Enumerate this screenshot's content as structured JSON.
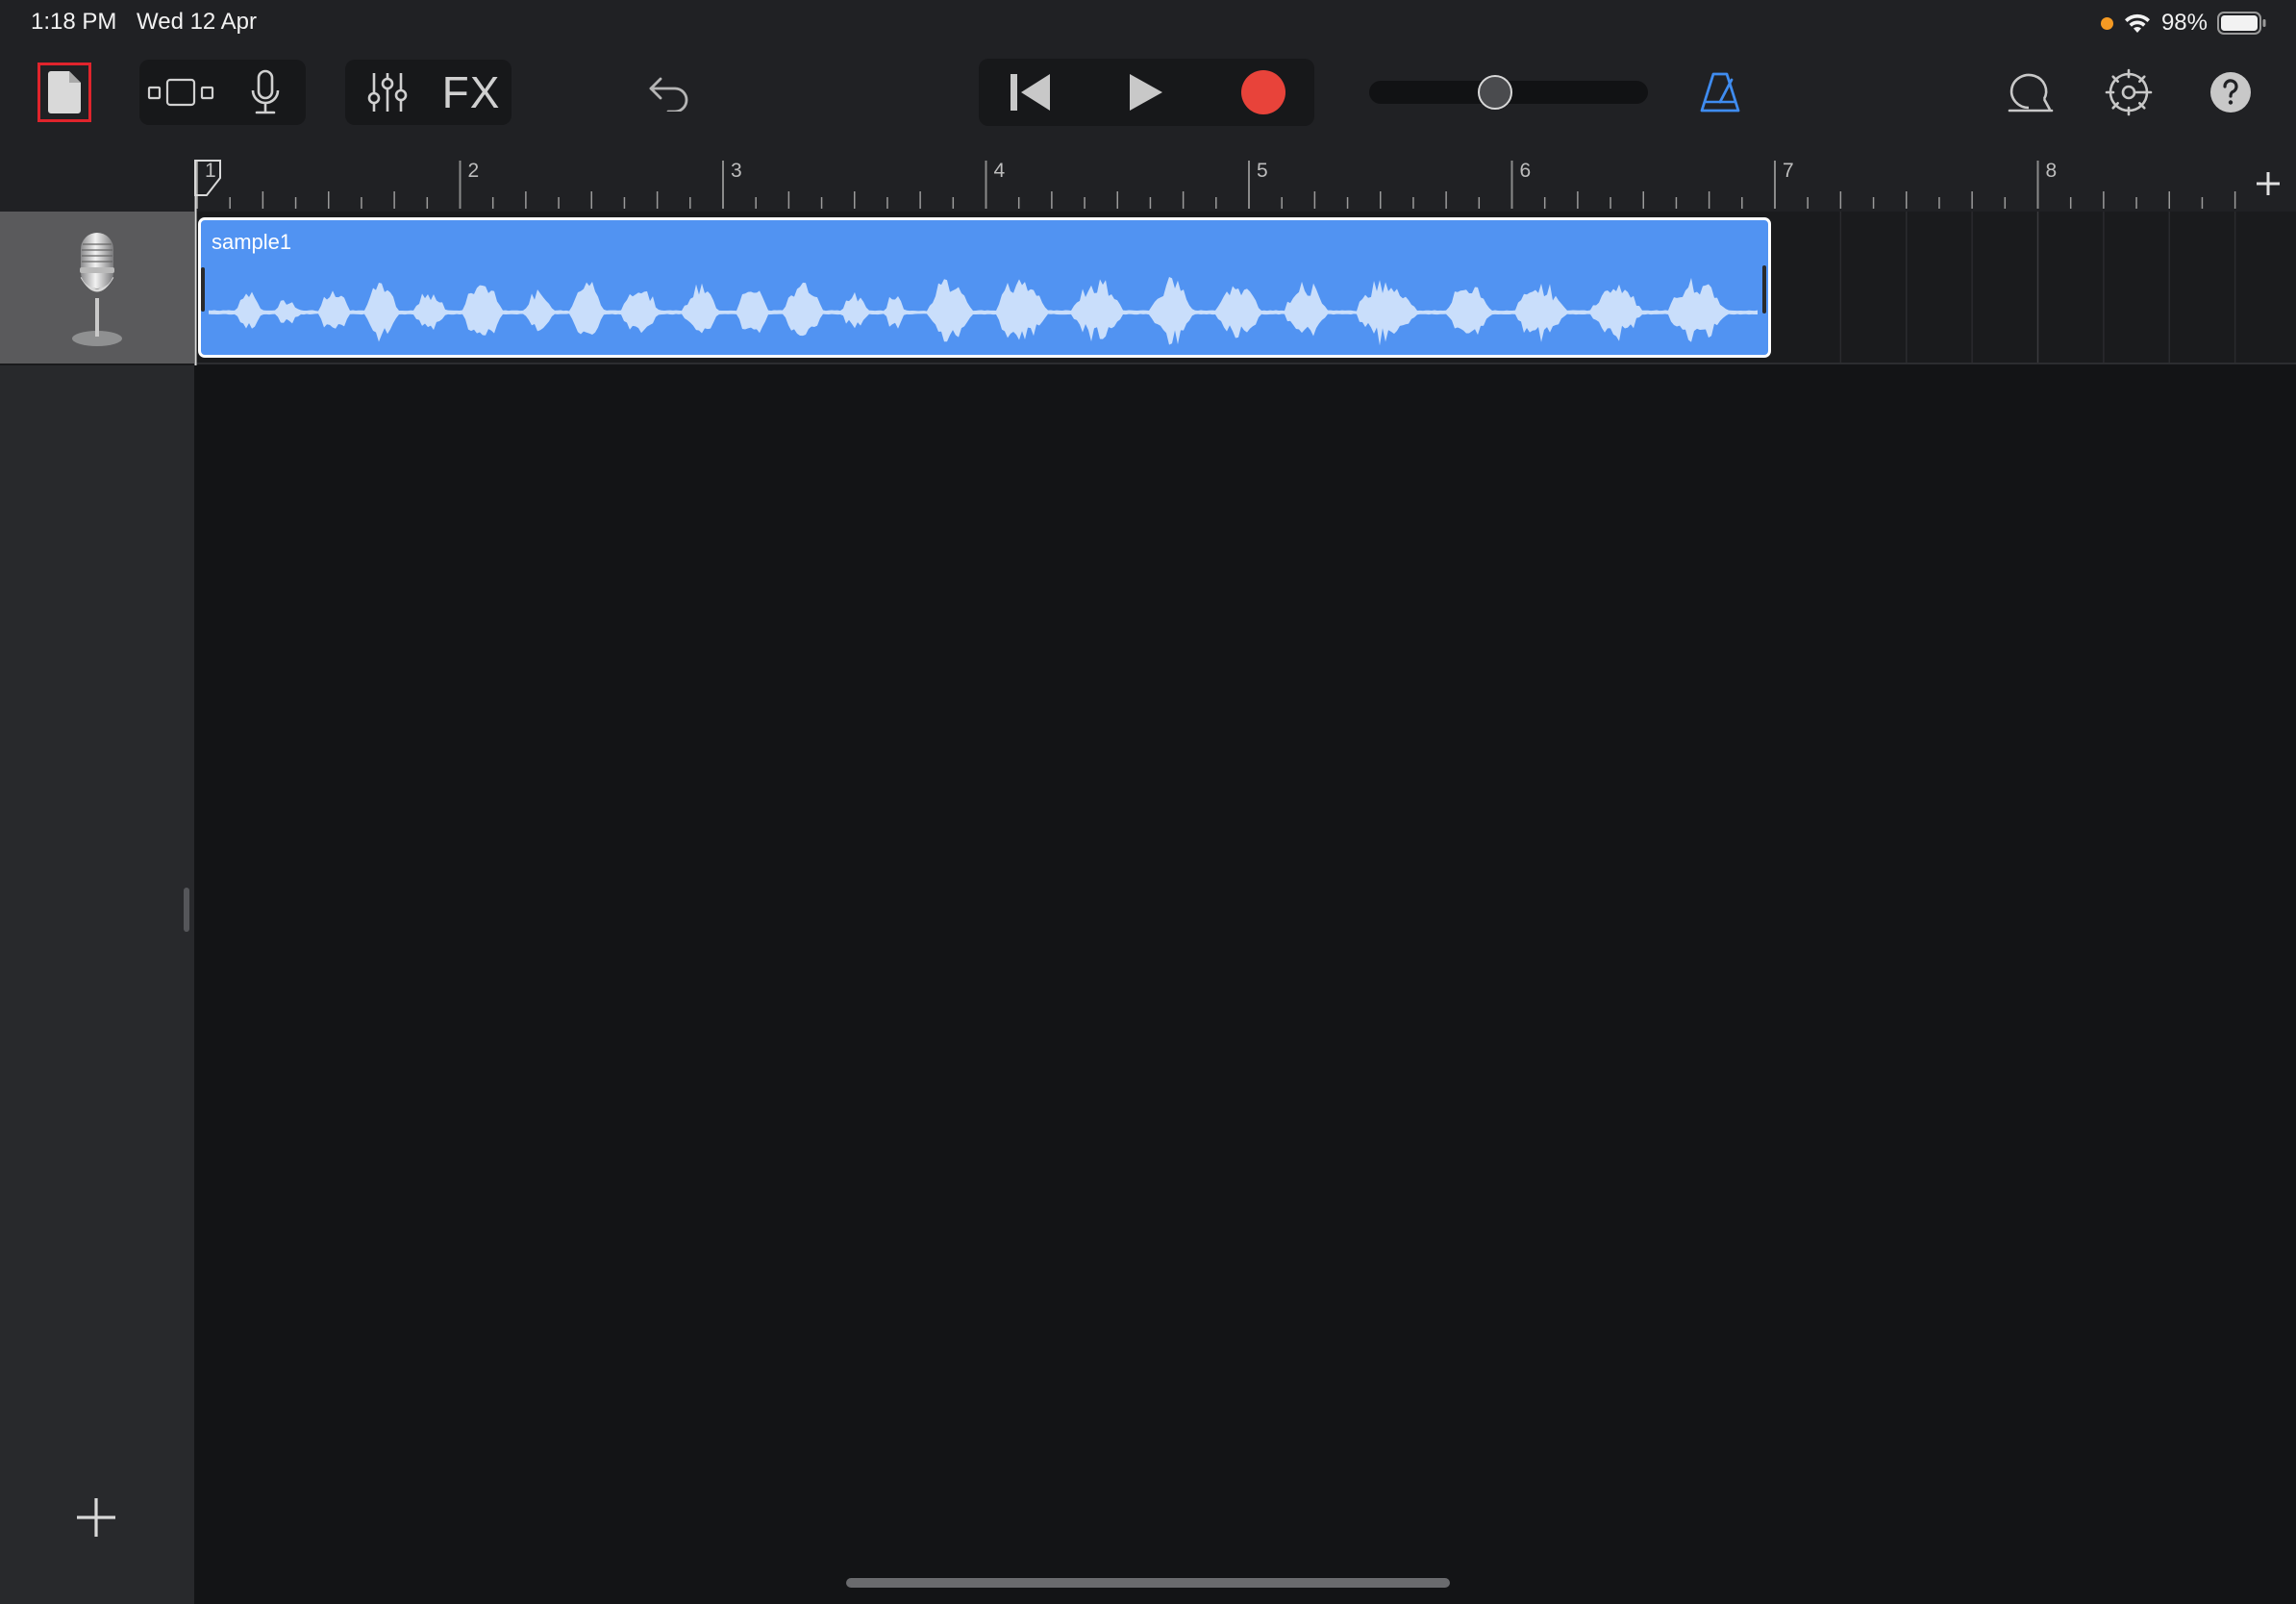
{
  "status_bar": {
    "time": "1:18 PM",
    "date": "Wed 12 Apr",
    "battery_percent": "98%",
    "battery_level": 0.98
  },
  "toolbar": {
    "fx_label": "FX",
    "volume_level": 0.45,
    "record_color": "#e8433a",
    "metronome_color": "#3f8cf0",
    "highlight_color": "#e0242c"
  },
  "ruler": {
    "bars": [
      "1",
      "2",
      "3",
      "4",
      "5",
      "6",
      "7",
      "8"
    ]
  },
  "track": {
    "instrument_icon": "microphone-icon"
  },
  "region": {
    "name": "sample1",
    "color": "#5193f2"
  }
}
